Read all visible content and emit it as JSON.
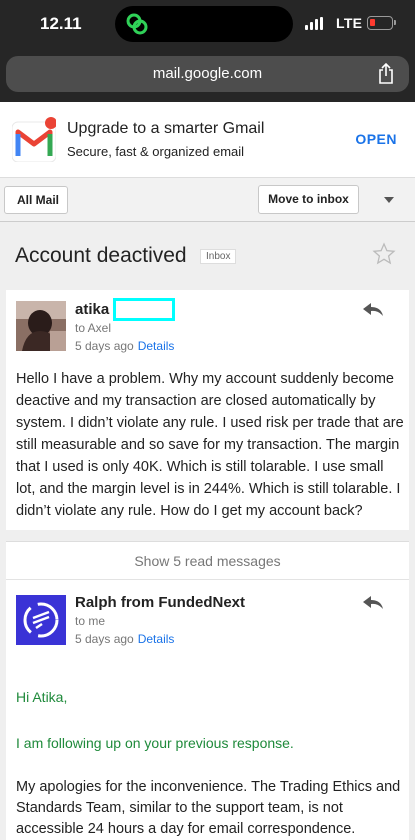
{
  "status_bar": {
    "time": "12.11",
    "network": "LTE",
    "battery_level": 0.15
  },
  "browser": {
    "url": "mail.google.com"
  },
  "promo": {
    "title": "Upgrade to a smarter Gmail",
    "subtitle": "Secure, fast & organized email",
    "open_label": "OPEN"
  },
  "toolbar": {
    "back_label": "All Mail",
    "move_label": "Move to inbox"
  },
  "thread": {
    "subject": "Account deactived",
    "label": "Inbox"
  },
  "message1": {
    "sender": "atika",
    "to": "to Axel",
    "date": "5 days ago",
    "details": "Details",
    "body": "Hello I have a problem. Why my account suddenly become deactive and my transaction are closed automatically by system. I didn’t violate any rule. I used risk per trade that are still measurable and so save for my transaction. The margin that I used is only 40K. Which is still tolarable. I use small lot, and the margin level is in 244%. Which is still tolarable. I didn’t violate any rule. How do I get my account back?"
  },
  "read_messages": {
    "label": "Show 5 read messages"
  },
  "message2": {
    "sender": "Ralph from FundedNext",
    "to": "to me",
    "date": "5 days ago",
    "details": "Details",
    "greeting": "Hi Atika,",
    "followup": "I am following up on your previous response.",
    "body": "My apologies for the inconvenience. The Trading Ethics and Standards Team, similar to the support team, is not accessible 24 hours a day for email correspondence. However, upon their"
  },
  "colors": {
    "accent": "#1a73e8",
    "quoted_text": "#1f8a3b",
    "highlight_box": "#00ffff",
    "brand_avatar": "#3a33d6"
  }
}
